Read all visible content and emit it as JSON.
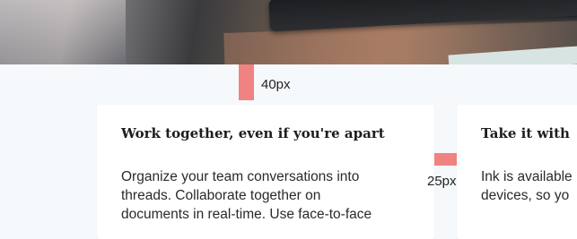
{
  "spacing": {
    "vertical_label": "40px",
    "horizontal_label": "25px",
    "marker_color": "#f08382"
  },
  "cards": [
    {
      "title": "Work together, even if you're apart",
      "body": "Organize your team conversations into\nthreads. Collaborate together on\ndocuments in real-time. Use face-to-face"
    },
    {
      "title": "Take it with",
      "body": "Ink is available\ndevices, so yo"
    }
  ],
  "colors": {
    "page_background": "#f6f9fb",
    "card_background": "#ffffff",
    "text": "#2a2a2a"
  }
}
